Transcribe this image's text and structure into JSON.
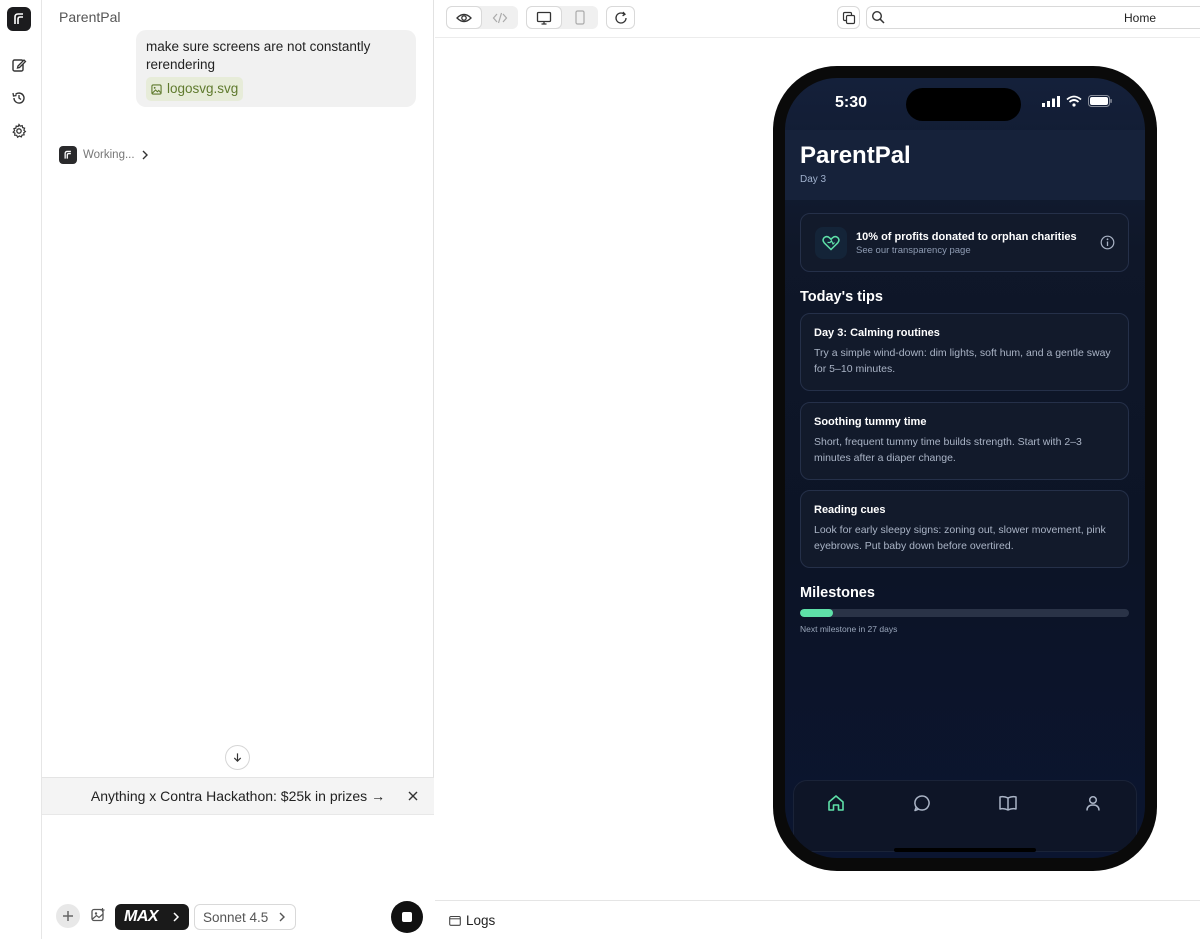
{
  "rail": {
    "icons": [
      "logo-icon",
      "new-chat-icon",
      "history-icon",
      "settings-icon"
    ]
  },
  "chat": {
    "title": "ParentPal",
    "message": "make sure screens are not constantly rerendering",
    "attachment": "logosvg.svg",
    "status": "Working...",
    "banner": "Anything x Contra Hackathon: $25k in prizes →",
    "max_label": "MAX",
    "model_label": "Sonnet 4.5"
  },
  "toolbar": {
    "url": "Home"
  },
  "logs_label": "Logs",
  "phone": {
    "time": "5:30",
    "app_title": "ParentPal",
    "app_subtitle": "Day 3",
    "donation": {
      "title": "10% of profits donated to orphan charities",
      "subtitle": "See our transparency page"
    },
    "tips_title": "Today's tips",
    "tips": [
      {
        "title": "Day 3: Calming routines",
        "body": "Try a simple wind-down: dim lights, soft hum, and a gentle sway for 5–10 minutes."
      },
      {
        "title": "Soothing tummy time",
        "body": "Short, frequent tummy time builds strength. Start with 2–3 minutes after a diaper change."
      },
      {
        "title": "Reading cues",
        "body": "Look for early sleepy signs: zoning out, slower movement, pink eyebrows. Put baby down before overtired."
      }
    ],
    "milestones_title": "Milestones",
    "milestone_progress": 0.1,
    "milestone_caption": "Next milestone in 27 days",
    "accent": "#5ee0a8",
    "tabs": [
      "home-icon",
      "chat-icon",
      "book-icon",
      "profile-icon"
    ]
  }
}
